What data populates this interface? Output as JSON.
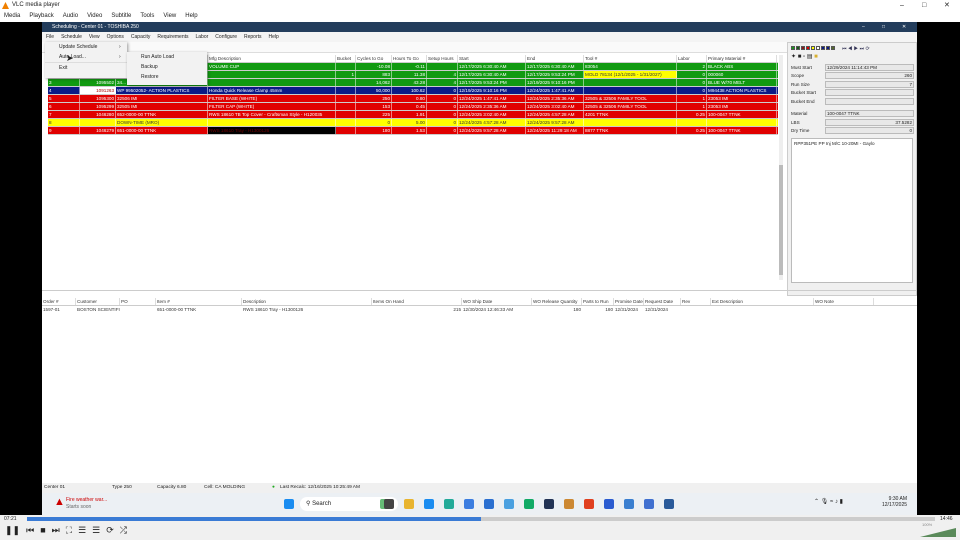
{
  "vlc": {
    "title": "VLC media player",
    "menu": [
      "Media",
      "Playback",
      "Audio",
      "Video",
      "Subtitle",
      "Tools",
      "View",
      "Help"
    ],
    "time_elapsed": "07:21",
    "time_total": "14:46",
    "volume": "100%",
    "progress": 0.5
  },
  "app": {
    "title": "Scheduling - Center 01 - TOSHIBA 250",
    "menu": [
      "File",
      "Schedule",
      "View",
      "Options",
      "Capacity",
      "Requirements",
      "Labor",
      "Configure",
      "Reports",
      "Help"
    ],
    "file_menu": [
      "Update Schedule",
      "Auto Load...",
      "Exit"
    ],
    "submenu": [
      "Run Auto Load",
      "Backup",
      "Restore"
    ]
  },
  "grid": {
    "headers": [
      "",
      "",
      "",
      "Mfg Description",
      "Bucket",
      "Cycles to Go",
      "Hours To Go",
      "Setup Hours",
      "Start",
      "End",
      "Tool #",
      "Labor",
      "Primary Material #"
    ],
    "rows": [
      {
        "color": "green",
        "cells": [
          "",
          "",
          "",
          "VOLUME CUP",
          "",
          "-10.08",
          "-0.11",
          "",
          "12/17/2025 6:30:40 AM",
          "12/17/2025 6:30:40 AM",
          "83054",
          "2",
          "BLACK ABS"
        ]
      },
      {
        "color": "green",
        "cells": [
          "",
          "",
          "",
          "",
          "1",
          "883",
          "11.38",
          "4",
          "12/17/2025 6:30:40 AM",
          "12/17/2025 9:53:24 PM",
          "MOLD 78134 (12/1/2025 - 1/31/2027)",
          "0",
          "000060"
        ]
      },
      {
        "color": "green",
        "cells": [
          "3",
          "1095502",
          "34...",
          "",
          "",
          "14,062",
          "43.28",
          "4",
          "12/17/2025 9:53:24 PM",
          "12/19/2025 9:10:16 PM",
          "",
          "0",
          "BLUE W/70 MELT"
        ]
      },
      {
        "color": "navy",
        "cells": [
          "4",
          "1091263",
          "WP 99502052- ACTION PLASTICS",
          "Honda Quick Release Clamp 45mm",
          "",
          "50,000",
          "100.62",
          "0",
          "12/19/2025 9:10:16 PM",
          "12/24/2025 1:47:41 AM",
          "",
          "0",
          "M94438 ACTION PLASTICS"
        ]
      },
      {
        "color": "red",
        "cells": [
          "5",
          "1095300",
          "32506 IMI",
          "FILTER BASE (WHITE)",
          "",
          "250",
          "0.80",
          "0",
          "12/24/2025 1:47:41 AM",
          "12/24/2025 2:35:36 AM",
          "32505 & 32506 FAMILY TOOL",
          "1",
          "23053 IMI"
        ]
      },
      {
        "color": "red",
        "cells": [
          "6",
          "1095299",
          "32505 IMI",
          "FILTER CAP (WHITE)",
          "",
          "153",
          "0.45",
          "0",
          "12/24/2025 2:35:36 AM",
          "12/24/2025 3:02:40 AM",
          "32505 & 32506 FAMILY TOOL",
          "1",
          "23053 IMI"
        ]
      },
      {
        "color": "red",
        "cells": [
          "7",
          "1046280",
          "652-0000-00 TTNK",
          "RWS 18610 TB Top Cover - Craftsman Style - H120035",
          "",
          "225",
          "1.91",
          "0",
          "12/24/2025 3:02:40 AM",
          "12/24/2025 4:57:28 AM",
          "4201 TTNK",
          "0.25",
          "100-0047 TTNK"
        ]
      },
      {
        "color": "yellow",
        "cells": [
          "8",
          "",
          "DOWN-TIME (MRO)",
          "",
          "",
          "0",
          "5.00",
          "0",
          "12/24/2025 4:57:28 AM",
          "12/24/2025 9:57:28 AM",
          "",
          "",
          ""
        ]
      },
      {
        "color": "red",
        "cells": [
          "9",
          "1046279",
          "651-0000-00 TTNK",
          "RWS 18610 Tray - H1300126",
          "",
          "180",
          "1.53",
          "0",
          "12/24/2025 9:57:28 AM",
          "12/24/2025 11:29:18 AM",
          "8877 TTNK",
          "0.25",
          "100-0047 TTNK"
        ]
      }
    ]
  },
  "details": {
    "fields": [
      {
        "label": "Must Start",
        "value": "12/29/2024 11:14:43 PM"
      },
      {
        "label": "Scope",
        "value": "260"
      },
      {
        "label": "Run Size",
        "value": "7"
      },
      {
        "label": "Bucket Start",
        "value": ""
      },
      {
        "label": "Bucket End",
        "value": ""
      },
      {
        "label": "Material",
        "value": "100-0047 TTNK"
      },
      {
        "label": "LBS",
        "value": "37.5282"
      },
      {
        "label": "Dry Time",
        "value": "0"
      }
    ],
    "note": "RPP351PE PP Inj M/C 10-20MI - Gaylo"
  },
  "orders": {
    "headers": [
      "Order #",
      "Customer",
      "PO",
      "Item #",
      "Description",
      "Items On Hand",
      "WO Ship Date",
      "WO Release Quantity",
      "Parts to Run",
      "Promise Date",
      "Request Date",
      "Rev",
      "Ext Description",
      "WO Note"
    ],
    "rows": [
      [
        "1597-01",
        "BOSTON SCIENTIFIC",
        "",
        "651-0000-00 TTNK",
        "RWS 18610 Tray - H1300126",
        "215",
        "12/30/2024 12:46:33 AM",
        "180",
        "180",
        "12/31/2024",
        "12/31/2024",
        "",
        "",
        ""
      ]
    ]
  },
  "status": {
    "center": "Center 01",
    "type": "Type 250",
    "capacity": "Capacity 6.80",
    "cell": "Cell: CA MOLDING",
    "recalc": "Last Recalc: 12/16/2025 10:25:49 AM"
  },
  "taskbar": {
    "weather_title": "Fire weather war...",
    "weather_sub": "Starts soon",
    "search": "Search",
    "time": "9:30 AM",
    "date": "12/17/2025"
  },
  "colors": {
    "green": "#119a11",
    "navy": "#0b1a86",
    "red": "#e00000",
    "yellow": "#ffff00"
  }
}
